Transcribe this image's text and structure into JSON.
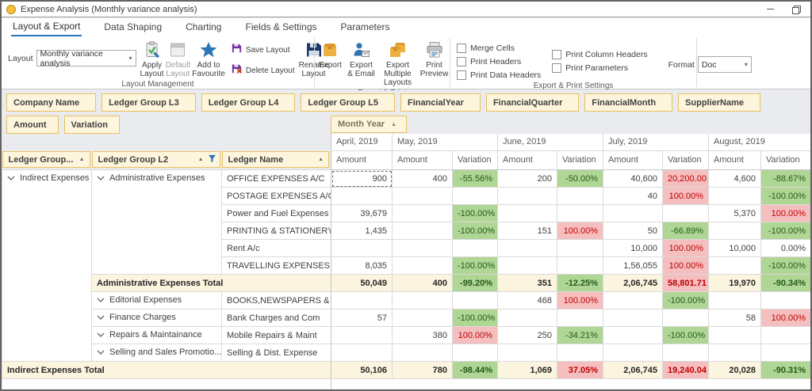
{
  "window": {
    "title": "Expense Analysis (Monthly variance analysis)"
  },
  "tabs": [
    "Layout & Export",
    "Data Shaping",
    "Charting",
    "Fields & Settings",
    "Parameters"
  ],
  "ribbon": {
    "layout_label": "Layout",
    "layout_value": "Monthly variance analysis",
    "buttons": {
      "apply": "Apply Layout",
      "default": "Default Layout",
      "favourite": "Add to Favourite",
      "save": "Save Layout",
      "delete": "Delete Layout",
      "rename": "Rename Layout",
      "export": "Export",
      "export_email": "Export & Email",
      "export_multiple": "Export Multiple Layouts",
      "print_preview": "Print Preview"
    },
    "checkboxes": [
      "Merge Cells",
      "Print Headers",
      "Print Data Headers",
      "Print Column Headers",
      "Print Parameters"
    ],
    "format_label": "Format",
    "format_value": "Doc",
    "group_labels": {
      "layout": "Layout Management",
      "export": "Export & Print",
      "settings": "Export & Print Settings"
    }
  },
  "pivot": {
    "filter_fields": [
      "Company Name",
      "Ledger Group L3",
      "Ledger Group L4",
      "Ledger Group L5",
      "FinancialYear",
      "FinancialQuarter",
      "FinancialMonth",
      "SupplierName"
    ],
    "data_fields": [
      "Amount",
      "Variation"
    ],
    "column_field": "Month Year",
    "row_headers": [
      {
        "label": "Ledger Group...",
        "sort": "asc",
        "filtered": false
      },
      {
        "label": "Ledger Group L2",
        "sort": "asc",
        "filtered": true
      },
      {
        "label": "Ledger Name",
        "sort": "asc",
        "filtered": false
      }
    ],
    "months": [
      {
        "label": "April, 2019",
        "cols": [
          "Amount"
        ]
      },
      {
        "label": "May, 2019",
        "cols": [
          "Amount",
          "Variation"
        ]
      },
      {
        "label": "June, 2019",
        "cols": [
          "Amount",
          "Variation"
        ]
      },
      {
        "label": "July, 2019",
        "cols": [
          "Amount",
          "Variation"
        ]
      },
      {
        "label": "August, 2019",
        "cols": [
          "Amount",
          "Variation"
        ]
      }
    ],
    "colors": {
      "positive_bg": "#AFD695",
      "negative_bg": "#F5BFBF",
      "total_bg": "#FBF4DE",
      "chip_bg": "#FDF5DC",
      "chip_border": "#E9C15F"
    },
    "rows": [
      {
        "kind": "data",
        "l1": {
          "text": "Indirect Expenses",
          "rowspan": 11
        },
        "l2": {
          "text": "Administrative Expenses",
          "rowspan": 6
        },
        "name": "OFFICE EXPENSES A/C",
        "cells": [
          {
            "v": "900",
            "c": "sel"
          },
          {
            "v": "400"
          },
          {
            "v": "-55.56%",
            "c": "g"
          },
          {
            "v": "200"
          },
          {
            "v": "-50.00%",
            "c": "g"
          },
          {
            "v": "40,600"
          },
          {
            "v": "20,200.00",
            "c": "r"
          },
          {
            "v": "4,600"
          },
          {
            "v": "-88.67%",
            "c": "g"
          }
        ]
      },
      {
        "kind": "data",
        "name": "POSTAGE EXPENSES A/C",
        "cells": [
          {},
          {},
          {},
          {},
          {},
          {
            "v": "40"
          },
          {
            "v": "100.00%",
            "c": "r"
          },
          {},
          {
            "v": "-100.00%",
            "c": "g"
          }
        ]
      },
      {
        "kind": "data",
        "name": "Power and Fuel Expenses",
        "cells": [
          {
            "v": "39,679"
          },
          {},
          {
            "v": "-100.00%",
            "c": "g"
          },
          {},
          {},
          {},
          {},
          {
            "v": "5,370"
          },
          {
            "v": "100.00%",
            "c": "r"
          }
        ]
      },
      {
        "kind": "data",
        "name": "PRINTING & STATIONERY A...",
        "cells": [
          {
            "v": "1,435"
          },
          {},
          {
            "v": "-100.00%",
            "c": "g"
          },
          {
            "v": "151"
          },
          {
            "v": "100.00%",
            "c": "r"
          },
          {
            "v": "50"
          },
          {
            "v": "-66.89%",
            "c": "g"
          },
          {},
          {
            "v": "-100.00%",
            "c": "g"
          }
        ]
      },
      {
        "kind": "data",
        "name": "Rent A/c",
        "cells": [
          {},
          {},
          {},
          {},
          {},
          {
            "v": "10,000"
          },
          {
            "v": "100.00%",
            "c": "r"
          },
          {
            "v": "10,000"
          },
          {
            "v": "0.00%"
          }
        ]
      },
      {
        "kind": "data",
        "name": "TRAVELLING EXPENSES A/C",
        "cells": [
          {
            "v": "8,035"
          },
          {},
          {
            "v": "-100.00%",
            "c": "g"
          },
          {},
          {},
          {
            "v": "1,56,055"
          },
          {
            "v": "100.00%",
            "c": "r"
          },
          {},
          {
            "v": "-100.00%",
            "c": "g"
          }
        ]
      },
      {
        "kind": "subtotal",
        "label": "Administrative Expenses Total",
        "span": 2,
        "cells": [
          {
            "v": "50,049"
          },
          {
            "v": "400"
          },
          {
            "v": "-99.20%",
            "c": "g"
          },
          {
            "v": "351"
          },
          {
            "v": "-12.25%",
            "c": "g"
          },
          {
            "v": "2,06,745"
          },
          {
            "v": "58,801.71",
            "c": "r"
          },
          {
            "v": "19,970"
          },
          {
            "v": "-90.34%",
            "c": "g"
          }
        ]
      },
      {
        "kind": "data",
        "l2": {
          "text": "Editorial Expenses",
          "rowspan": 1
        },
        "name": "BOOKS,NEWSPAPERS & PE...",
        "cells": [
          {},
          {},
          {},
          {
            "v": "468"
          },
          {
            "v": "100.00%",
            "c": "r"
          },
          {},
          {
            "v": "-100.00%",
            "c": "g"
          },
          {},
          {}
        ]
      },
      {
        "kind": "data",
        "l2": {
          "text": "Finance Charges",
          "rowspan": 1
        },
        "name": "Bank Charges and Com",
        "cells": [
          {
            "v": "57"
          },
          {},
          {
            "v": "-100.00%",
            "c": "g"
          },
          {},
          {},
          {},
          {},
          {
            "v": "58"
          },
          {
            "v": "100.00%",
            "c": "r"
          }
        ]
      },
      {
        "kind": "data",
        "l2": {
          "text": "Repairs & Maintainance",
          "rowspan": 1
        },
        "name": "Mobile Repairs & Maint",
        "cells": [
          {},
          {
            "v": "380"
          },
          {
            "v": "100.00%",
            "c": "r"
          },
          {
            "v": "250"
          },
          {
            "v": "-34.21%",
            "c": "g"
          },
          {},
          {
            "v": "-100.00%",
            "c": "g"
          },
          {},
          {}
        ]
      },
      {
        "kind": "data",
        "l2": {
          "text": "Selling and Sales Promotio...",
          "rowspan": 1
        },
        "name": "Selling & Dist. Expense",
        "cells": [
          {},
          {},
          {},
          {},
          {},
          {},
          {},
          {},
          {}
        ]
      },
      {
        "kind": "grandtotal",
        "label": "Indirect Expenses Total",
        "span": 3,
        "cells": [
          {
            "v": "50,106"
          },
          {
            "v": "780"
          },
          {
            "v": "-98.44%",
            "c": "g"
          },
          {
            "v": "1,069"
          },
          {
            "v": "37.05%",
            "c": "r"
          },
          {
            "v": "2,06,745"
          },
          {
            "v": "19,240.04",
            "c": "r"
          },
          {
            "v": "20,028"
          },
          {
            "v": "-90.31%",
            "c": "g"
          }
        ]
      },
      {
        "kind": "filler"
      }
    ]
  }
}
